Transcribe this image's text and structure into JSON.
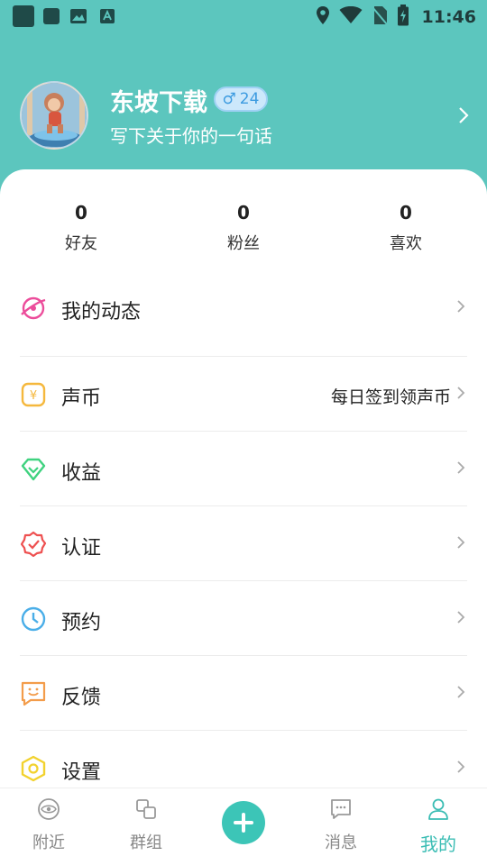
{
  "status_bar": {
    "time": "11:46"
  },
  "profile": {
    "name": "东坡下载",
    "gender_symbol": "♂",
    "age": "24",
    "bio": "写下关于你的一句话"
  },
  "stats": [
    {
      "value": "0",
      "label": "好友"
    },
    {
      "value": "0",
      "label": "粉丝"
    },
    {
      "value": "0",
      "label": "喜欢"
    }
  ],
  "menu": [
    {
      "label": "我的动态",
      "icon": "planet-icon"
    },
    {
      "label": "声币",
      "icon": "coin-icon",
      "extra": "每日签到领声币"
    },
    {
      "label": "收益",
      "icon": "diamond-icon"
    },
    {
      "label": "认证",
      "icon": "verified-badge-icon"
    },
    {
      "label": "预约",
      "icon": "clock-icon"
    },
    {
      "label": "反馈",
      "icon": "feedback-icon"
    },
    {
      "label": "设置",
      "icon": "settings-hexagon-icon"
    }
  ],
  "bottom_nav": [
    {
      "label": "附近",
      "icon": "nearby-icon"
    },
    {
      "label": "群组",
      "icon": "group-icon"
    },
    {
      "label": "",
      "icon": "plus-icon"
    },
    {
      "label": "消息",
      "icon": "message-icon"
    },
    {
      "label": "我的",
      "icon": "profile-icon",
      "active": true
    }
  ],
  "colors": {
    "header": "#5cc6be",
    "accent": "#3bbdb4",
    "badge_text": "#3c9be0"
  }
}
